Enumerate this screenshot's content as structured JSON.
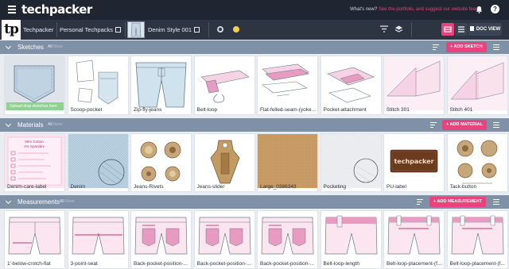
{
  "topbar": {
    "brand": "techpacker",
    "whatsnew_label": "What's new?",
    "whatsnew_link": "See the portfolio, and suggest our website feed",
    "help": "?"
  },
  "nav": {
    "logo": "tp",
    "crumb_1": "Techpacker",
    "crumb_2": "Personal Techpacks",
    "crumb_3": "Denim Style 001",
    "doc_view_label": "DOC VIEW",
    "accent": "#e8437c"
  },
  "sketches": {
    "title": "Sketches",
    "count": "All",
    "count_sub": "None",
    "add_label": "+ ADD SKETCH",
    "upload_overlay": "Upload drop sketches here",
    "items": [
      "",
      "Scoop-pocket",
      "Zip-fly-jeans",
      "Belt-loop",
      "Flat-felled-seam-(yoke...",
      "Pocket-attachment",
      "Stitch 301",
      "Stitch 401"
    ]
  },
  "materials": {
    "title": "Materials",
    "count": "All",
    "count_sub": "None",
    "add_label": "+ ADD MATERIAL",
    "care_label": {
      "line1": "99% Cotton",
      "line2": "2% Spandex"
    },
    "pu_label": "techpacker",
    "items": [
      "Denim-care-label",
      "Denim",
      "Jeans-Rivets",
      "Jeans-slider",
      "Large_0386343",
      "Pocketing",
      "PU-label",
      "Tack-button"
    ]
  },
  "measurements": {
    "title": "Measurements",
    "count": "All",
    "count_sub": "None",
    "add_label": "+ ADD MEASUREMENT",
    "items": [
      "1'-below-crotch-flat",
      "3-point-seat",
      "Back-pocket-position-...",
      "Back-pocket-position-...",
      "Back-pocket-position-...",
      "Belt-loop-length",
      "Belt-loop-placement-(f...",
      "Belt-loop-placement-(f..."
    ]
  }
}
